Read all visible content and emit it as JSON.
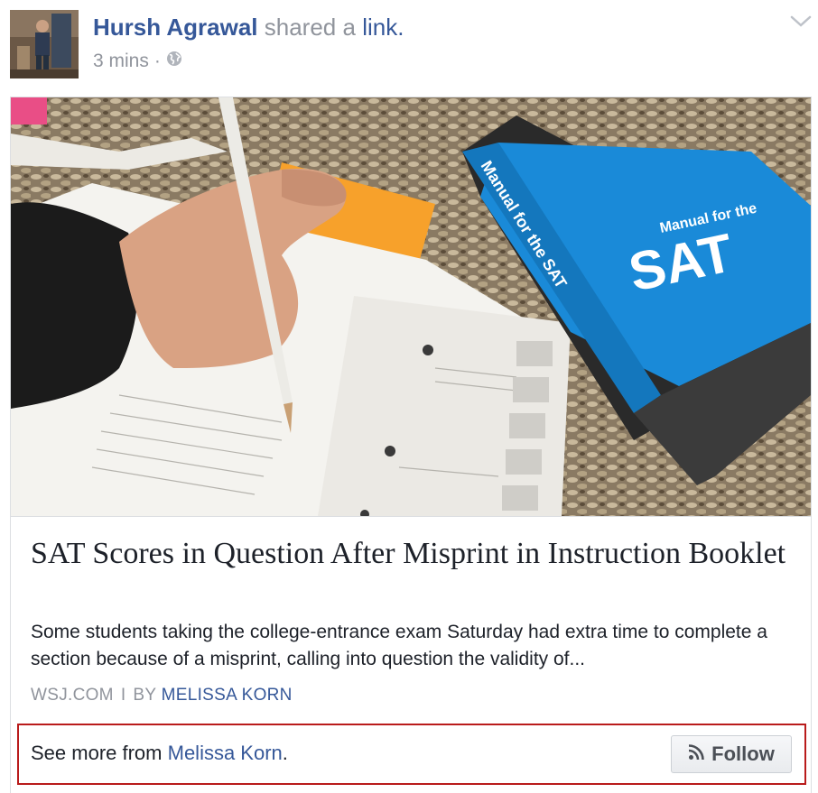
{
  "post": {
    "author": "Hursh Agrawal",
    "action": "shared a",
    "object": "link.",
    "time": "3 mins",
    "dot": "·",
    "privacy_icon": "globe-icon",
    "menu_icon": "chevron-down-icon"
  },
  "article": {
    "image_alt": "Student filling answers beside Manual for the SAT",
    "book_text_top": "Manual for the",
    "book_text_big": "SAT",
    "book_spine": "Manual for the SAT",
    "title": "SAT Scores in Question After Misprint in Instruction Booklet",
    "description": "Some students taking the college-entrance exam Saturday had extra time to complete a section because of a misprint, calling into question the validity of...",
    "domain": "WSJ.COM",
    "separator": "I",
    "by_label": "BY",
    "byline": "MELISSA KORN"
  },
  "follow": {
    "prefix": "See more from",
    "author": "Melissa Korn",
    "suffix": ".",
    "button_label": "Follow",
    "button_icon": "rss-icon"
  },
  "colors": {
    "link": "#365899",
    "muted": "#90949c",
    "highlight_border": "#b91b1b",
    "sat_blue": "#1a8ad8"
  }
}
